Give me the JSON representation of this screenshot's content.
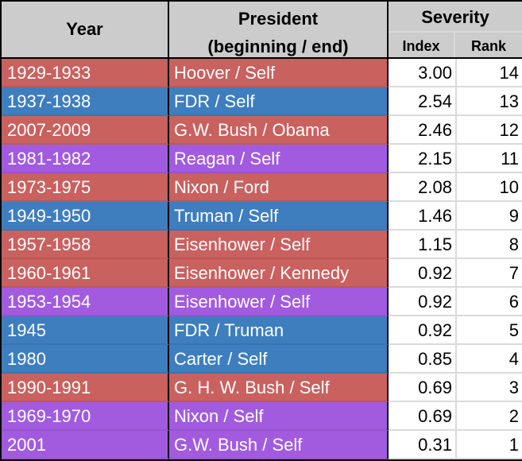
{
  "header": {
    "year": "Year",
    "president_line1": "President",
    "president_line2": "(beginning / end)",
    "severity": "Severity",
    "index": "Index",
    "rank": "Rank"
  },
  "colors": {
    "republican": "#c9615f",
    "democrat": "#3e7ebf",
    "mixed": "#a25bdf"
  },
  "rows": [
    {
      "year": "1929-1933",
      "president": "Hoover / Self",
      "index": "3.00",
      "rank": "14",
      "party": "republican"
    },
    {
      "year": "1937-1938",
      "president": "FDR / Self",
      "index": "2.54",
      "rank": "13",
      "party": "democrat"
    },
    {
      "year": "2007-2009",
      "president": "G.W. Bush / Obama",
      "index": "2.46",
      "rank": "12",
      "party": "republican"
    },
    {
      "year": "1981-1982",
      "president": "Reagan / Self",
      "index": "2.15",
      "rank": "11",
      "party": "mixed"
    },
    {
      "year": "1973-1975",
      "president": "Nixon / Ford",
      "index": "2.08",
      "rank": "10",
      "party": "republican"
    },
    {
      "year": "1949-1950",
      "president": "Truman / Self",
      "index": "1.46",
      "rank": "9",
      "party": "democrat"
    },
    {
      "year": "1957-1958",
      "president": "Eisenhower / Self",
      "index": "1.15",
      "rank": "8",
      "party": "republican"
    },
    {
      "year": "1960-1961",
      "president": "Eisenhower / Kennedy",
      "index": "0.92",
      "rank": "7",
      "party": "republican"
    },
    {
      "year": "1953-1954",
      "president": "Eisenhower / Self",
      "index": "0.92",
      "rank": "6",
      "party": "mixed"
    },
    {
      "year": "1945",
      "president": "FDR / Truman",
      "index": "0.92",
      "rank": "5",
      "party": "democrat"
    },
    {
      "year": "1980",
      "president": "Carter / Self",
      "index": "0.85",
      "rank": "4",
      "party": "democrat"
    },
    {
      "year": "1990-1991",
      "president": "G. H. W. Bush / Self",
      "index": "0.69",
      "rank": "3",
      "party": "republican"
    },
    {
      "year": "1969-1970",
      "president": "Nixon / Self",
      "index": "0.69",
      "rank": "2",
      "party": "mixed"
    },
    {
      "year": "2001",
      "president": "G.W. Bush / Self",
      "index": "0.31",
      "rank": "1",
      "party": "mixed"
    }
  ]
}
